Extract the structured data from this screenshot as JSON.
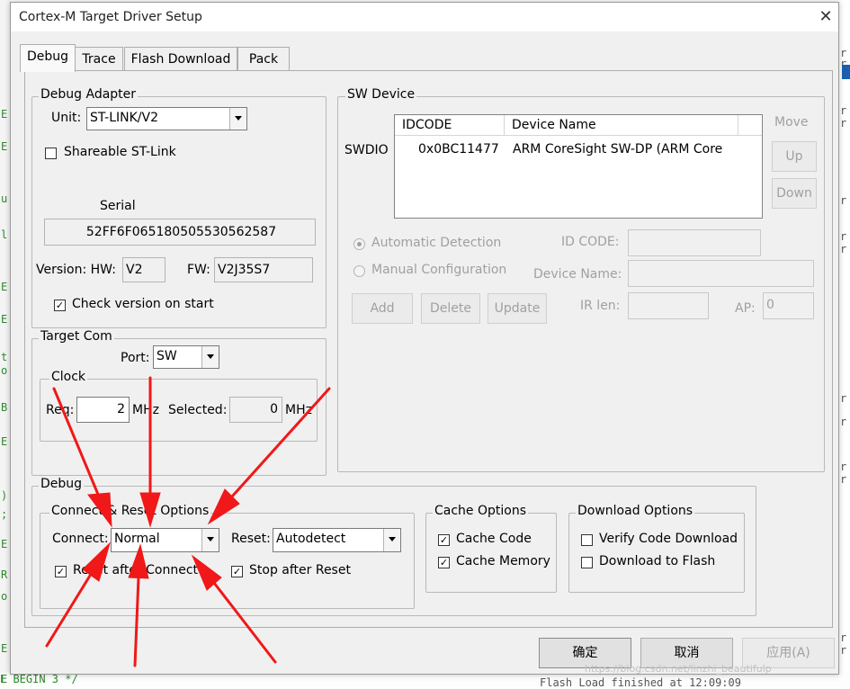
{
  "window": {
    "title": "Cortex-M Target Driver Setup",
    "close_glyph": "✕"
  },
  "tabs": [
    {
      "label": "Debug",
      "active": true
    },
    {
      "label": "Trace"
    },
    {
      "label": "Flash Download"
    },
    {
      "label": "Pack"
    }
  ],
  "debug_adapter": {
    "legend": "Debug Adapter",
    "unit_label": "Unit:",
    "unit_value": "ST-LINK/V2",
    "shareable_label": "Shareable ST-Link",
    "shareable_checked": false,
    "serial_label": "Serial",
    "serial_value": "52FF6F065180505530562587",
    "version_label": "Version: HW:",
    "hw_value": "V2",
    "fw_label": "FW:",
    "fw_value": "V2J35S7",
    "check_version_label": "Check version on start",
    "check_version_checked": true
  },
  "target_com": {
    "legend": "Target Com",
    "port_label": "Port:",
    "port_value": "SW",
    "clock_legend": "Clock",
    "req_label": "Req:",
    "req_value": "2",
    "req_unit": "MHz",
    "selected_label": "Selected:",
    "selected_value": "0",
    "selected_unit": "MHz"
  },
  "sw_device": {
    "legend": "SW Device",
    "row_label": "SWDIO",
    "columns": [
      "IDCODE",
      "Device Name"
    ],
    "rows": [
      {
        "idcode": "0x0BC11477",
        "device_name": "ARM CoreSight SW-DP (ARM Core"
      }
    ],
    "move_label": "Move",
    "up_label": "Up",
    "down_label": "Down",
    "auto_detect_label": "Automatic Detection",
    "manual_config_label": "Manual Configuration",
    "id_code_label": "ID CODE:",
    "device_name_label": "Device Name:",
    "add_label": "Add",
    "delete_label": "Delete",
    "update_label": "Update",
    "ir_len_label": "IR len:",
    "ap_label": "AP:",
    "ap_value": "0"
  },
  "debug": {
    "legend": "Debug",
    "connect_reset_legend": "Connect & Reset Options",
    "connect_label": "Connect:",
    "connect_value": "Normal",
    "reset_label": "Reset:",
    "reset_value": "Autodetect",
    "reset_after_connect_label": "Reset after Connect",
    "reset_after_connect_checked": true,
    "stop_after_reset_label": "Stop after Reset",
    "stop_after_reset_checked": true
  },
  "cache_options": {
    "legend": "Cache Options",
    "cache_code_label": "Cache Code",
    "cache_code_checked": true,
    "cache_memory_label": "Cache Memory",
    "cache_memory_checked": true
  },
  "download_options": {
    "legend": "Download Options",
    "verify_label": "Verify Code Download",
    "verify_checked": false,
    "download_flash_label": "Download to Flash",
    "download_flash_checked": false
  },
  "footer": {
    "ok_label": "确定",
    "cancel_label": "取消",
    "apply_label": "应用(A)"
  },
  "background": {
    "left_code_chars": [
      "E",
      "E",
      "u",
      "l",
      "E",
      "E",
      "t",
      "o",
      "B",
      "E",
      ")",
      ";",
      "E",
      "R",
      "o",
      "E",
      "E"
    ],
    "right_code_chars": [
      "r",
      "r",
      "r",
      "r",
      "r",
      "r",
      "r",
      "r",
      "r",
      "r",
      "r",
      "r",
      "r"
    ],
    "bottom_code": "E BEGIN 3 */",
    "bottom_right_code": "Flash Load finished at 12:09:09"
  },
  "watermark": "https://blog.csdn.net/linzhi_beautifulp"
}
